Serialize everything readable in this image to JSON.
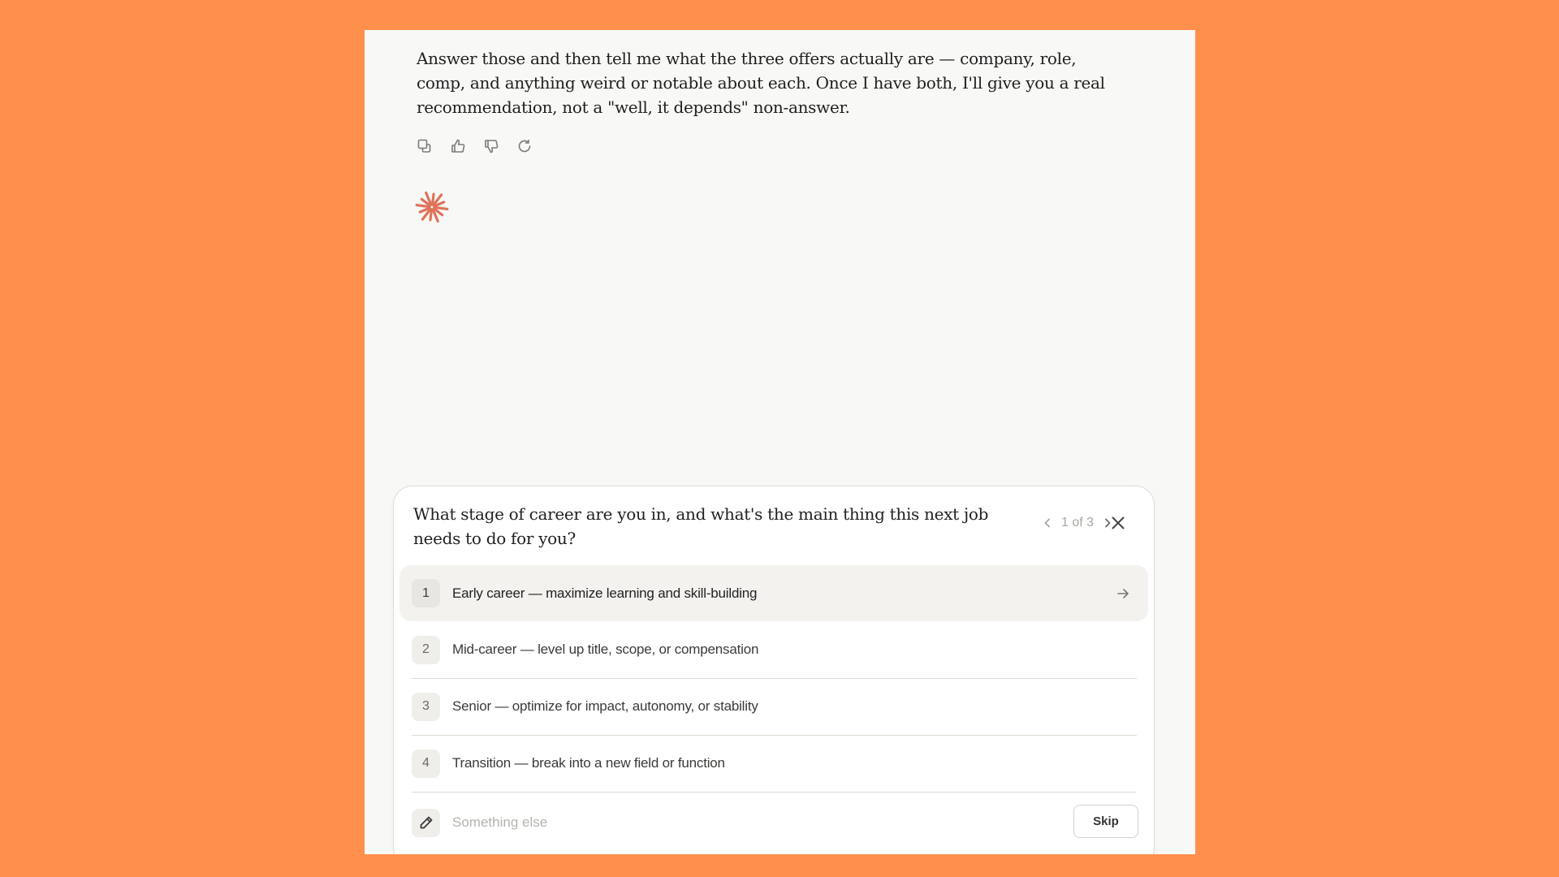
{
  "message": {
    "text": "Answer those and then tell me what the three offers actually are — company, role, comp, and anything weird or notable about each. Once I have both, I'll give you a real recommendation, not a \"well, it depends\" non-answer."
  },
  "message_actions": [
    {
      "name": "copy-icon"
    },
    {
      "name": "thumbs-up-icon"
    },
    {
      "name": "thumbs-down-icon"
    },
    {
      "name": "retry-icon"
    }
  ],
  "colors": {
    "background": "#FF8F4C",
    "panel": "#F8F8F6",
    "spark": "#E0735A"
  },
  "question": {
    "text": "What stage of career are you in, and what's the main thing this next job needs to do for you?",
    "pager": "1 of 3"
  },
  "options": [
    {
      "num": "1",
      "label": "Early career — maximize learning and skill-building"
    },
    {
      "num": "2",
      "label": "Mid-career — level up title, scope, or compensation"
    },
    {
      "num": "3",
      "label": "Senior — optimize for impact, autonomy, or stability"
    },
    {
      "num": "4",
      "label": "Transition — break into a new field or function"
    }
  ],
  "other": {
    "placeholder": "Something else",
    "skip_label": "Skip"
  }
}
